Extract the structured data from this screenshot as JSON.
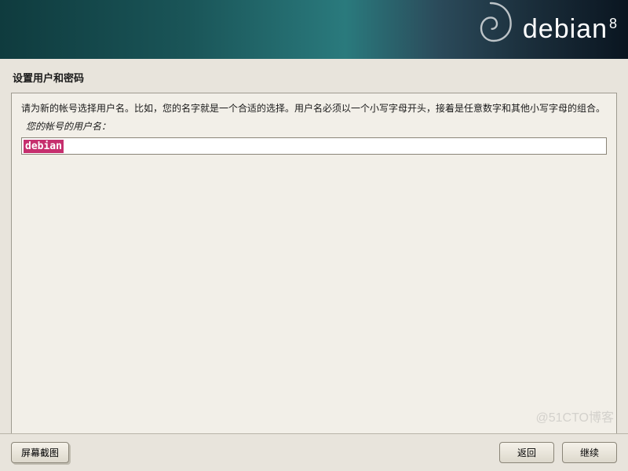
{
  "banner": {
    "logo_text": "debian",
    "version": "8"
  },
  "page": {
    "title": "设置用户和密码",
    "instruction": "请为新的帐号选择用户名。比如，您的名字就是一个合适的选择。用户名必须以一个小写字母开头，接着是任意数字和其他小写字母的组合。",
    "field_label": "您的帐号的用户名：",
    "username_value": "debian"
  },
  "footer": {
    "screenshot": "屏幕截图",
    "back": "返回",
    "continue": "继续"
  },
  "watermark": "@51CTO博客"
}
